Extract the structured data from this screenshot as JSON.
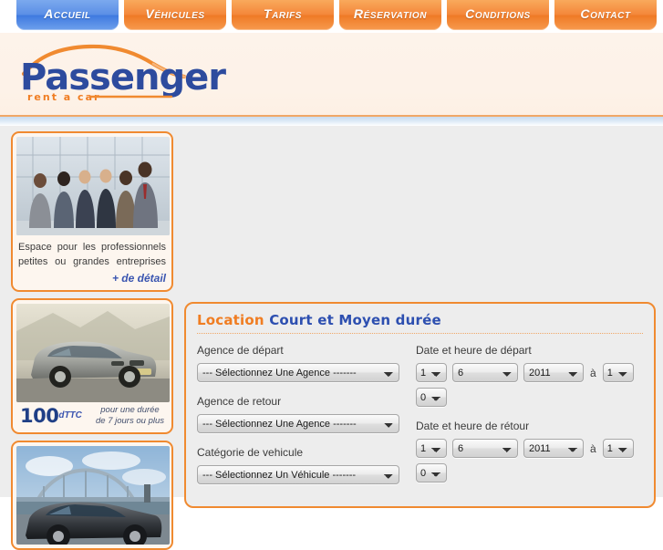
{
  "nav": {
    "items": [
      {
        "label": "Accueil",
        "active": true
      },
      {
        "label": "Véhicules",
        "active": false
      },
      {
        "label": "Tarifs",
        "active": false
      },
      {
        "label": "Réservation",
        "active": false
      },
      {
        "label": "Conditions",
        "active": false
      },
      {
        "label": "Contact",
        "active": false
      }
    ]
  },
  "brand": {
    "name": "Passenger",
    "tagline": "rent a car",
    "name_color": "#2d4b9e",
    "tagline_color": "#f07d22",
    "swoosh_color": "#f08a30"
  },
  "sidebar": {
    "promos": [
      {
        "image": "business-people-photo",
        "text": "Espace pour les professionnels petites ou grandes entreprises",
        "link_label": "+ de détail"
      },
      {
        "image": "silver-renault-megane-photo",
        "price_amount": "100",
        "price_unit": "dTTC",
        "price_note_line1": "pour une durée",
        "price_note_line2": "de 7 jours ou plus"
      },
      {
        "image": "dark-sedan-on-bridge-photo"
      }
    ]
  },
  "booking": {
    "title_part1": "Location",
    "title_part2": "Court et Moyen durée",
    "departure_agency": {
      "label": "Agence de départ",
      "value": "--- Sélectionnez Une Agence -------"
    },
    "return_agency": {
      "label": "Agence de retour",
      "value": "--- Sélectionnez Une Agence -------"
    },
    "vehicle_category": {
      "label": "Catégorie de vehicule",
      "value": "--- Sélectionnez Un Véhicule -------"
    },
    "departure_datetime": {
      "label": "Date et heure de départ",
      "day": "1",
      "month": "6",
      "year": "2011",
      "separator": "à",
      "hour": "1",
      "minute": "0"
    },
    "return_datetime": {
      "label": "Date et heure de rétour",
      "day": "1",
      "month": "6",
      "year": "2011",
      "separator": "à",
      "hour": "1",
      "minute": "0"
    }
  },
  "colors": {
    "orange": "#f08a30",
    "orange_text": "#f07d22",
    "blue_text": "#2d4fb0",
    "header_bg": "#fdf2e8",
    "body_bg": "#ededed"
  }
}
